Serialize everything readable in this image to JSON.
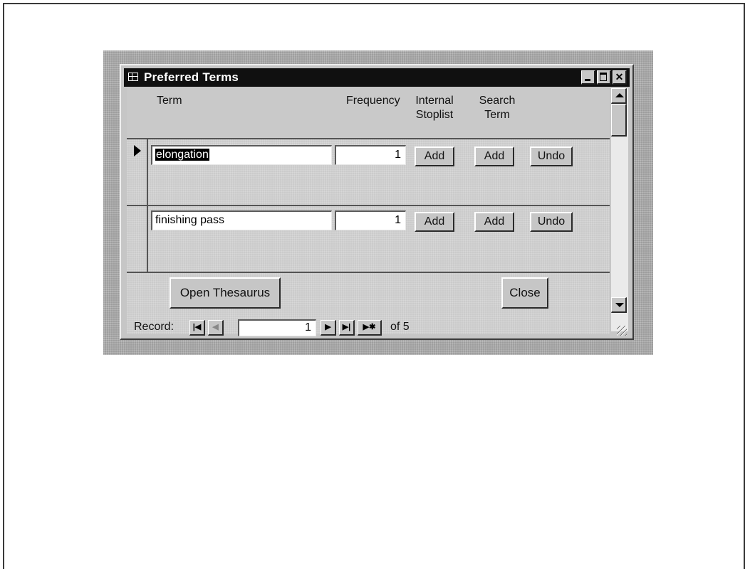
{
  "window": {
    "title": "Preferred Terms"
  },
  "header": {
    "term_label": "Term",
    "frequency_label": "Frequency",
    "internal_stoplist_label_line1": "Internal",
    "internal_stoplist_label_line2": "Stoplist",
    "search_term_label_line1": "Search",
    "search_term_label_line2": "Term"
  },
  "rows": [
    {
      "term": "elongation",
      "frequency": "1",
      "add_stoplist_label": "Add",
      "add_search_label": "Add",
      "undo_label": "Undo"
    },
    {
      "term": "finishing pass",
      "frequency": "1",
      "add_stoplist_label": "Add",
      "add_search_label": "Add",
      "undo_label": "Undo"
    }
  ],
  "footer": {
    "open_thesaurus_label": "Open Thesaurus",
    "close_label": "Close"
  },
  "navigation": {
    "record_label": "Record:",
    "current_record": "1",
    "of_label": "of 5"
  }
}
